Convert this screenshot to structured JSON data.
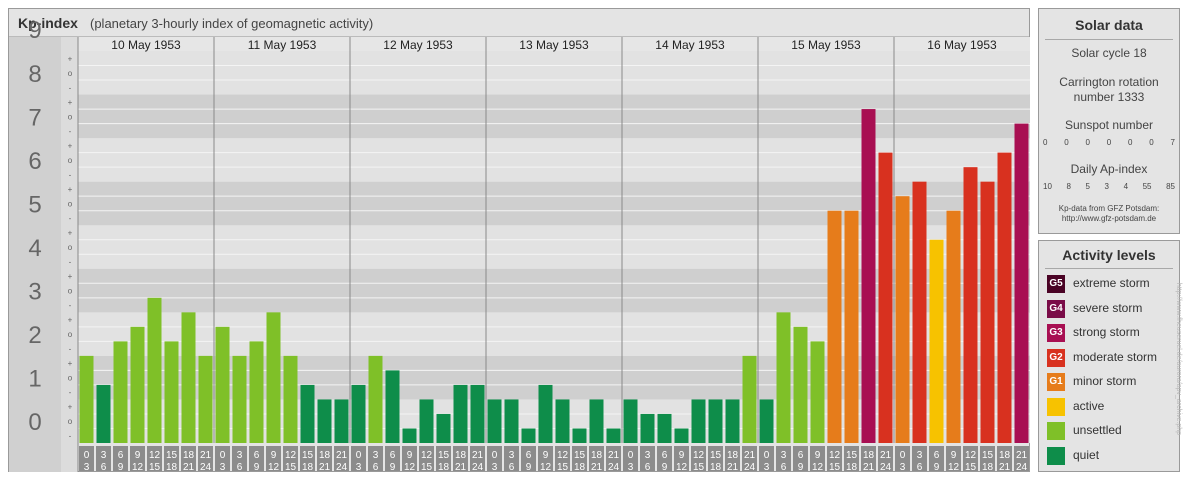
{
  "header": {
    "title": "Kp-index",
    "subtitle": "(planetary 3-hourly index of geomagnetic activity)"
  },
  "chart_data": {
    "type": "bar",
    "title": "Kp-index",
    "subtitle": "(planetary 3-hourly index of geomagnetic activity)",
    "ylim": [
      0,
      9
    ],
    "y_ticks": [
      "0",
      "1",
      "2",
      "3",
      "4",
      "5",
      "6",
      "7",
      "8",
      "9"
    ],
    "third_marks": [
      "+",
      "o",
      "-"
    ],
    "days": [
      "10 May 1953",
      "11 May 1953",
      "12 May 1953",
      "13 May 1953",
      "14 May 1953",
      "15 May 1953",
      "16 May 1953"
    ],
    "interval_labels": [
      [
        "0",
        "3"
      ],
      [
        "3",
        "6"
      ],
      [
        "6",
        "9"
      ],
      [
        "9",
        "12"
      ],
      [
        "12",
        "15"
      ],
      [
        "15",
        "18"
      ],
      [
        "18",
        "21"
      ],
      [
        "21",
        "24"
      ]
    ],
    "values": [
      [
        2.0,
        1.333,
        2.333,
        2.667,
        3.333,
        2.333,
        3.0,
        2.0
      ],
      [
        2.667,
        2.0,
        2.333,
        3.0,
        2.0,
        1.333,
        1.0,
        1.0
      ],
      [
        1.333,
        2.0,
        1.667,
        0.333,
        1.0,
        0.667,
        1.333,
        1.333
      ],
      [
        1.0,
        1.0,
        0.333,
        1.333,
        1.0,
        0.333,
        1.0,
        0.333
      ],
      [
        1.0,
        0.667,
        0.667,
        0.333,
        1.0,
        1.0,
        1.0,
        2.0
      ],
      [
        1.0,
        3.0,
        2.667,
        2.333,
        5.333,
        5.333,
        7.667,
        6.667
      ],
      [
        5.667,
        6.0,
        4.667,
        5.333,
        6.333,
        6.0,
        6.667,
        7.333
      ]
    ],
    "color_scale": [
      {
        "min": 0,
        "max": 2,
        "level": "quiet",
        "color": "#0e8d4a"
      },
      {
        "min": 2,
        "max": 4,
        "level": "unsettled",
        "color": "#7fc028"
      },
      {
        "min": 4,
        "max": 5,
        "level": "active",
        "color": "#f7c200"
      },
      {
        "min": 5,
        "max": 6,
        "level": "minor storm",
        "color": "#e67c1b"
      },
      {
        "min": 6,
        "max": 7,
        "level": "moderate storm",
        "color": "#d8311f"
      },
      {
        "min": 7,
        "max": 8,
        "level": "strong storm",
        "color": "#a80f52"
      },
      {
        "min": 8,
        "max": 9,
        "level": "severe storm",
        "color": "#7a0c48"
      },
      {
        "min": 9,
        "max": 10,
        "level": "extreme storm",
        "color": "#4a0325"
      }
    ]
  },
  "solar": {
    "title": "Solar data",
    "cycle": "Solar cycle 18",
    "carrington_line1": "Carrington rotation",
    "carrington_line2": "number 1333",
    "sunspot_title": "Sunspot number",
    "sunspot_values": [
      "0",
      "0",
      "0",
      "0",
      "0",
      "0",
      "7"
    ],
    "ap_title": "Daily Ap-index",
    "ap_values": [
      "10",
      "8",
      "5",
      "3",
      "4",
      "55",
      "85"
    ],
    "credit_line1": "Kp-data from GFZ Potsdam:",
    "credit_line2": "http://www.gfz-potsdam.de"
  },
  "activity": {
    "title": "Activity levels",
    "levels": [
      {
        "badge": "G5",
        "label": "extreme storm",
        "color": "#4a0325"
      },
      {
        "badge": "G4",
        "label": "severe storm",
        "color": "#7a0c48"
      },
      {
        "badge": "G3",
        "label": "strong storm",
        "color": "#a80f52"
      },
      {
        "badge": "G2",
        "label": "moderate storm",
        "color": "#d8311f"
      },
      {
        "badge": "G1",
        "label": "minor storm",
        "color": "#e67c1b"
      },
      {
        "badge": "",
        "label": "active",
        "color": "#f7c200"
      },
      {
        "badge": "",
        "label": "unsettled",
        "color": "#7fc028"
      },
      {
        "badge": "",
        "label": "quiet",
        "color": "#0e8d4a"
      }
    ]
  },
  "watermark": "http://www.fheuseruel.de/aurora/apv_archive.php"
}
